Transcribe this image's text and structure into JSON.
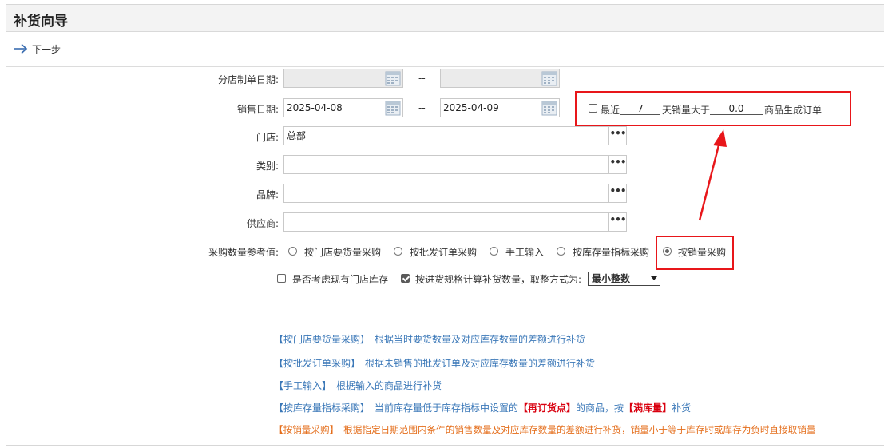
{
  "title": "补货向导",
  "toolbar": {
    "next_label": "下一步"
  },
  "form": {
    "branch_date_label": "分店制单日期:",
    "branch_date_from": "",
    "branch_date_to": "",
    "sales_date_label": "销售日期:",
    "sales_date_from": "2025-04-08",
    "sales_date_to": "2025-04-09",
    "range_sep": "--",
    "store_label": "门店:",
    "store_value": "总部",
    "category_label": "类别:",
    "category_value": "",
    "brand_label": "品牌:",
    "brand_value": "",
    "supplier_label": "供应商:",
    "supplier_value": "",
    "more_btn": "•••"
  },
  "recent_sales": {
    "checked": false,
    "prefix": "最近",
    "days": "7",
    "mid": "天销量大于",
    "threshold": "0.0",
    "suffix": "商品生成订单"
  },
  "purchase": {
    "label": "采购数量参考值:",
    "options": [
      "按门店要货量采购",
      "按批发订单采购",
      "手工输入",
      "按库存量指标采购",
      "按销量采购"
    ],
    "selected": "按销量采购"
  },
  "options": {
    "consider_stock": {
      "label": "是否考虑现有门店库存",
      "checked": false
    },
    "by_spec": {
      "label": "按进货规格计算补货数量，取整方式为:",
      "checked": true
    },
    "rounding_value": "最小整数"
  },
  "notes": [
    {
      "tag": "【按门店要货量采购】",
      "text": "根据当时要货数量及对应库存数量的差额进行补货"
    },
    {
      "tag": "【按批发订单采购】",
      "text": "根据未销售的批发订单及对应库存数量的差额进行补货"
    },
    {
      "tag": "【手工输入】",
      "text": "根据输入的商品进行补货"
    },
    {
      "tag": "【按库存量指标采购】",
      "text1": "当前库存量低于库存指标中设置的",
      "hl1": "【再订货点】",
      "text2": "的商品，按",
      "hl2": "【满库量】",
      "text3": "补货"
    },
    {
      "tag": "【按销量采购】",
      "text": "根据指定日期范围内条件的销售数量及对应库存数量的差额进行补货，销量小于等于库存时或库存为负时直接取销量"
    }
  ],
  "colors": {
    "note_blue": "#3b78b8",
    "note_red": "#d9000f",
    "note_orange": "#e46d1a",
    "highlight_box": "#e8161a"
  }
}
